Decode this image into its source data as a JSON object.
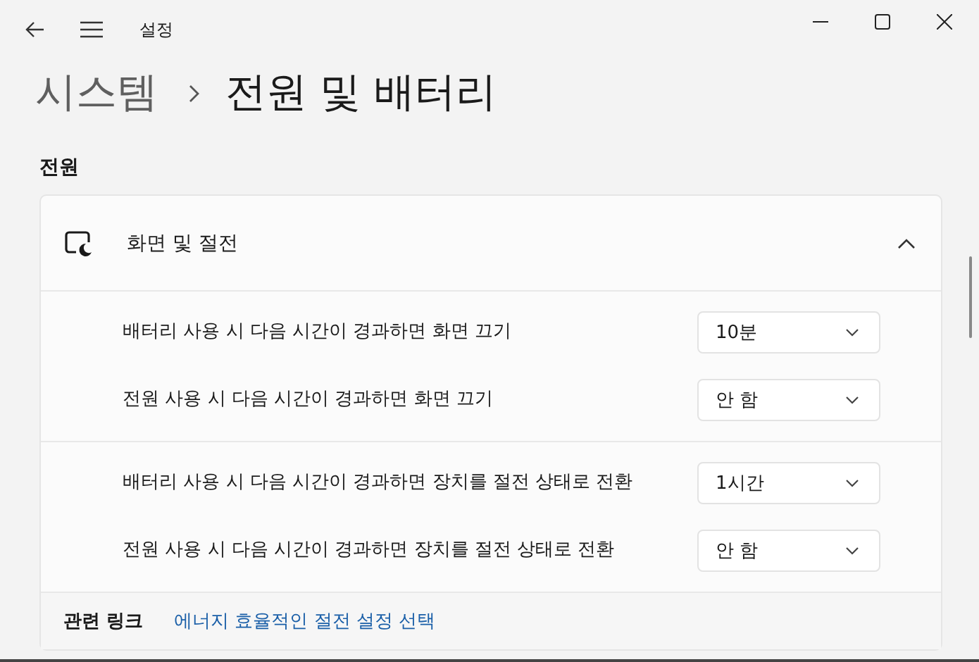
{
  "window": {
    "title": "설정"
  },
  "breadcrumb": {
    "parent": "시스템",
    "current": "전원 및 배터리"
  },
  "section": {
    "title": "전원"
  },
  "card": {
    "title": "화면 및 절전",
    "expanded": true,
    "groups": [
      {
        "settings": [
          {
            "label": "배터리 사용 시 다음 시간이 경과하면 화면 끄기",
            "value": "10분"
          },
          {
            "label": "전원 사용 시 다음 시간이 경과하면 화면 끄기",
            "value": "안 함"
          }
        ]
      },
      {
        "settings": [
          {
            "label": "배터리 사용 시 다음 시간이 경과하면 장치를 절전 상태로 전환",
            "value": "1시간"
          },
          {
            "label": "전원 사용 시 다음 시간이 경과하면 장치를 절전 상태로 전환",
            "value": "안 함"
          }
        ]
      }
    ]
  },
  "related": {
    "label": "관련 링크",
    "link": "에너지 효율적인 절전 설정 선택"
  }
}
